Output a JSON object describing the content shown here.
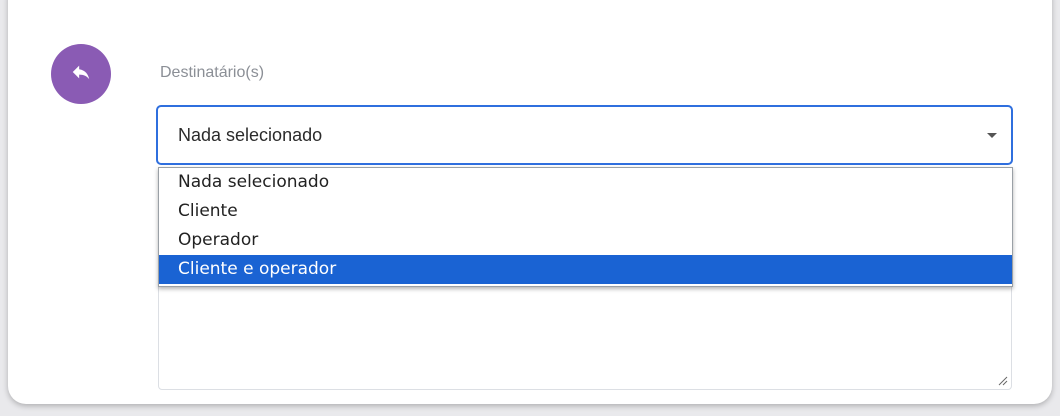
{
  "form": {
    "reply_icon": "reply-arrow-icon",
    "field_label": "Destinatário(s)",
    "select": {
      "value": "Nada selecionado"
    },
    "dropdown": {
      "options": [
        {
          "label": "Nada selecionado"
        },
        {
          "label": "Cliente"
        },
        {
          "label": "Operador"
        },
        {
          "label": "Cliente e operador"
        }
      ],
      "highlighted_index": 3
    }
  },
  "colors": {
    "accent": "#8a5bb4",
    "focus_border": "#2f6fde",
    "highlight": "#1a63d3"
  }
}
